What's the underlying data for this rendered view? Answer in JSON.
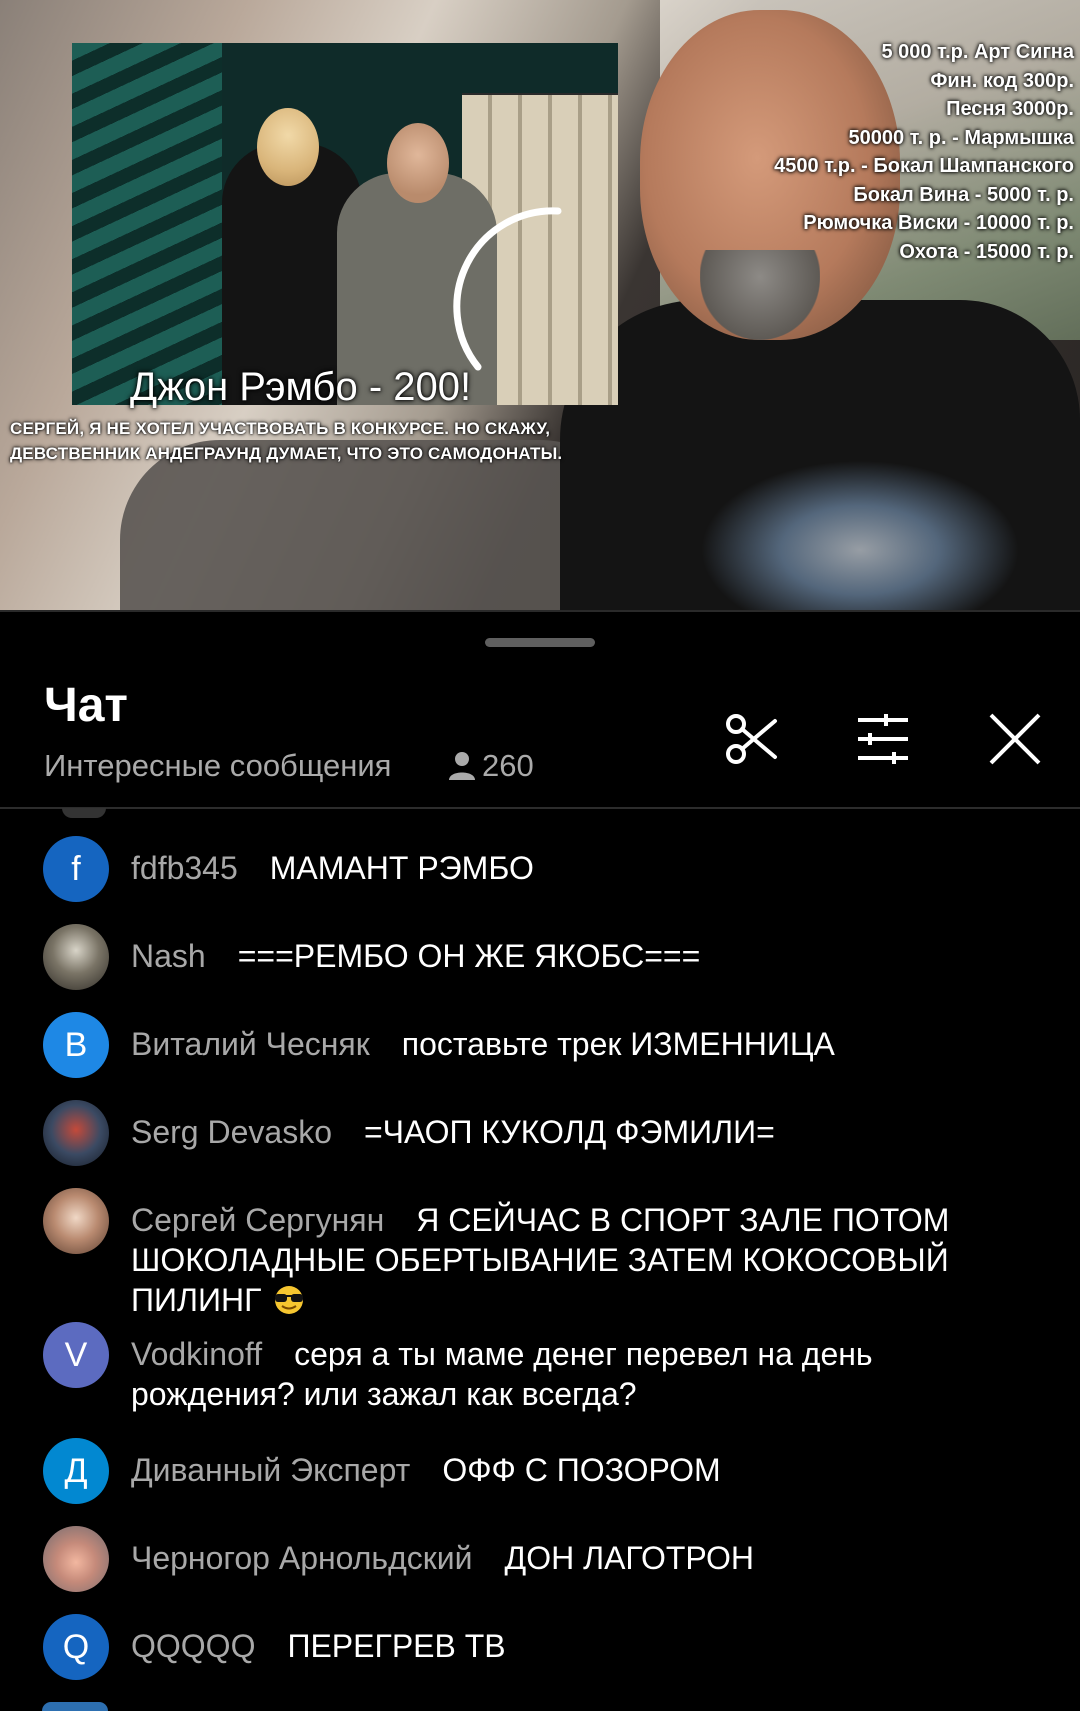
{
  "video": {
    "photo_title": "Джон Рэмбо - 200!",
    "photo_caption": "СЕРГЕЙ, Я НЕ ХОТЕЛ УЧАСТВОВАТЬ В КОНКУРСЕ. НО СКАЖУ, ДЕВСТВЕННИК АНДЕГРАУНД ДУМАЕТ, ЧТО ЭТО САМОДОНАТЫ.",
    "price_list": [
      "5 000 т.р. Арт Сигна",
      "Фин. код 300р.",
      "Песня 3000р.",
      "50000 т. р. - Мармышка",
      "4500 т.р. - Бокал Шампанского",
      "Бокал Вина - 5000 т. р.",
      "Рюмочка Виски - 10000 т. р.",
      "Охота - 15000 т. р."
    ]
  },
  "chat": {
    "title": "Чат",
    "subtitle": "Интересные сообщения",
    "viewers": "260",
    "icons": {
      "clip": "scissors-icon",
      "filter": "sliders-icon",
      "close": "close-icon",
      "viewers": "person-icon"
    }
  },
  "messages": [
    {
      "avatar_letter": "f",
      "avatar_color": "#1565c0",
      "author": "fdfb345",
      "text": "МАМАНТ РЭМБО"
    },
    {
      "avatar_letter": "",
      "avatar_color": "#6b6b5f",
      "author": "Nash",
      "text": "===РЕМБО ОН ЖЕ ЯКОБС==="
    },
    {
      "avatar_letter": "В",
      "avatar_color": "#1e88e5",
      "author": "Виталий Чесняк",
      "text": "поставьте трек ИЗМЕННИЦА"
    },
    {
      "avatar_letter": "",
      "avatar_color": "#3b4a63",
      "author": "Serg Devasko",
      "text": "=ЧАОП КУКОЛД ФЭМИЛИ="
    },
    {
      "avatar_letter": "",
      "avatar_color": "#b98a70",
      "author": "Сергей Сергунян",
      "text": "Я СЕЙЧАС В СПОРТ ЗАЛЕ ПОТОМ ШОКОЛАДНЫЕ ОБЕРТЫВАНИЕ ЗАТЕМ КОКОСОВЫЙ ПИЛИНГ"
    },
    {
      "avatar_letter": "V",
      "avatar_color": "#5c6bc0",
      "author": "Vodkinoff",
      "text": "серя а ты маме денег перевел на день рождения? или зажал как всегда?"
    },
    {
      "avatar_letter": "Д",
      "avatar_color": "#0288d1",
      "author": "Диванный Эксперт",
      "text": "ОФФ С ПОЗОРОМ"
    },
    {
      "avatar_letter": "",
      "avatar_color": "#c58a7a",
      "author": "Черногор Арнольдский",
      "text": "ДОН ЛАГОТРОН"
    },
    {
      "avatar_letter": "Q",
      "avatar_color": "#1565c0",
      "author": "QQQQQ",
      "text": "ПЕРЕГРЕВ ТВ"
    }
  ]
}
